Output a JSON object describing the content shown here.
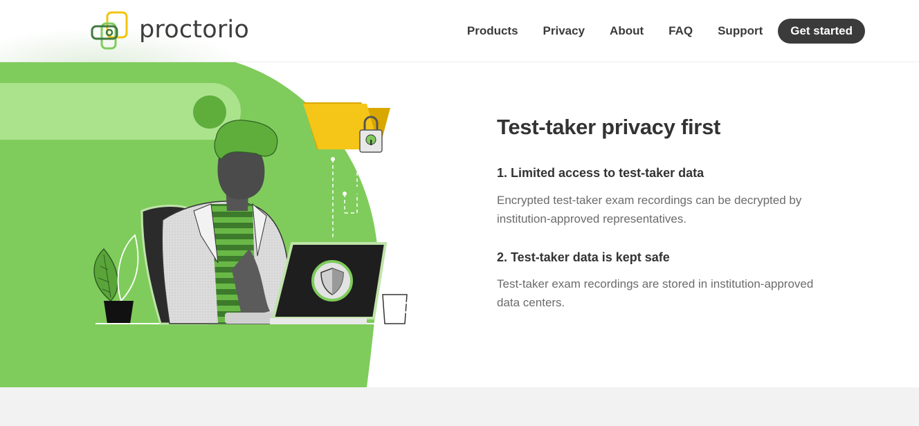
{
  "brand": {
    "name": "proctorio",
    "colors": {
      "green": "#7fcc5c",
      "yellow": "#f5c518",
      "dark": "#3b3b3b"
    }
  },
  "nav": {
    "items": [
      {
        "label": "Products"
      },
      {
        "label": "Privacy"
      },
      {
        "label": "About"
      },
      {
        "label": "FAQ"
      },
      {
        "label": "Support"
      }
    ],
    "cta_label": "Get started"
  },
  "hero": {
    "title": "Test-taker privacy first",
    "items": [
      {
        "heading": "1. Limited access to test-taker data",
        "text": "Encrypted test-taker exam recordings can be decrypted by institution-approved representatives."
      },
      {
        "heading": "2. Test-taker data is kept safe",
        "text": "Test-taker exam recordings are stored in institution-approved data centers."
      }
    ]
  },
  "icons": {
    "logo": "proctorio-logo-icon",
    "folder_lock": "locked-folder-icon",
    "shield": "shield-icon"
  }
}
